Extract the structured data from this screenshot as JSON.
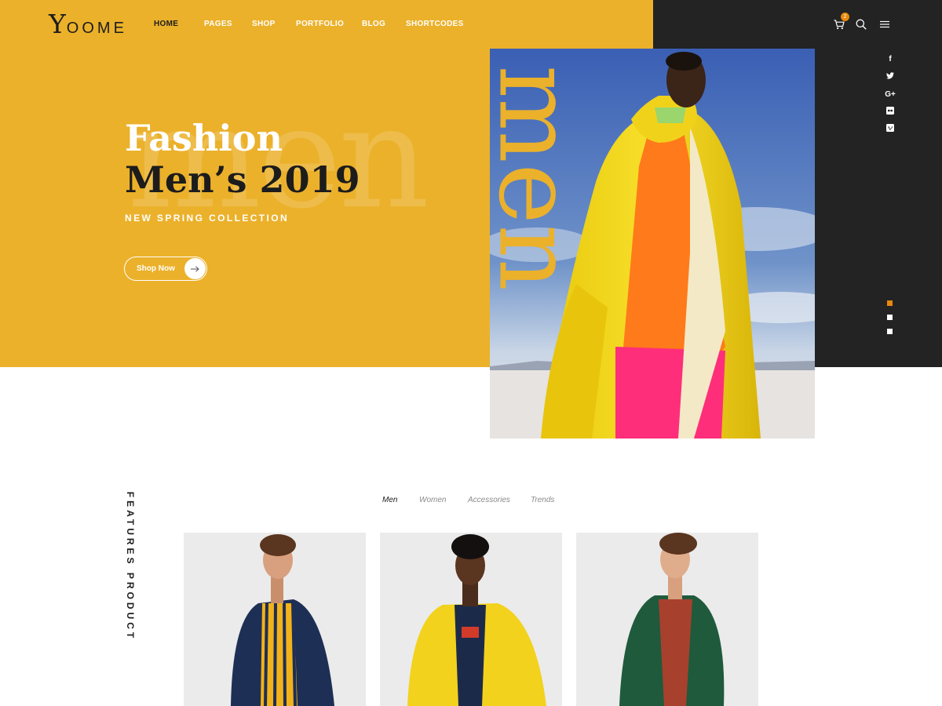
{
  "brand": {
    "logo_initial": "Y",
    "logo_rest": "OOME"
  },
  "nav": {
    "items": [
      {
        "label": "HOME",
        "active": true
      },
      {
        "label": "PAGES",
        "active": false
      },
      {
        "label": "SHOP",
        "active": false
      },
      {
        "label": "PORTFOLIO",
        "active": false
      },
      {
        "label": "BLOG",
        "active": false
      },
      {
        "label": "SHORTCODES",
        "active": false
      }
    ]
  },
  "header": {
    "cart_count": "2",
    "icons": [
      "cart-icon",
      "search-icon",
      "menu-icon"
    ]
  },
  "social": {
    "items": [
      {
        "icon": "facebook-icon",
        "glyph": "f"
      },
      {
        "icon": "twitter-icon",
        "glyph": "t"
      },
      {
        "icon": "google-plus-icon",
        "glyph": "G+"
      },
      {
        "icon": "flickr-icon",
        "glyph": "••"
      },
      {
        "icon": "vimeo-icon",
        "glyph": "v"
      }
    ]
  },
  "slider": {
    "dots": 3,
    "active_index": 0
  },
  "hero": {
    "ghost_word": "men",
    "vertical_word": "men",
    "title_line1": "Fashion",
    "title_line2": "Men’s 2019",
    "subtitle": "NEW SPRING COLLECTION",
    "cta_label": "Shop Now"
  },
  "features": {
    "section_label": "FEATURES PRODUCT",
    "tabs": [
      {
        "label": "Men",
        "active": true
      },
      {
        "label": "Women",
        "active": false
      },
      {
        "label": "Accessories",
        "active": false
      },
      {
        "label": "Trends",
        "active": false
      }
    ],
    "products": [
      {
        "jacket": "navy jacket, striped yellow shirt"
      },
      {
        "jacket": "yellow jacket"
      },
      {
        "jacket": "green jacket"
      }
    ]
  },
  "colors": {
    "accent_yellow": "#ebb12b",
    "dark_panel": "#232323",
    "accent_orange": "#e8890c",
    "text_dark": "#1c1c1c"
  }
}
